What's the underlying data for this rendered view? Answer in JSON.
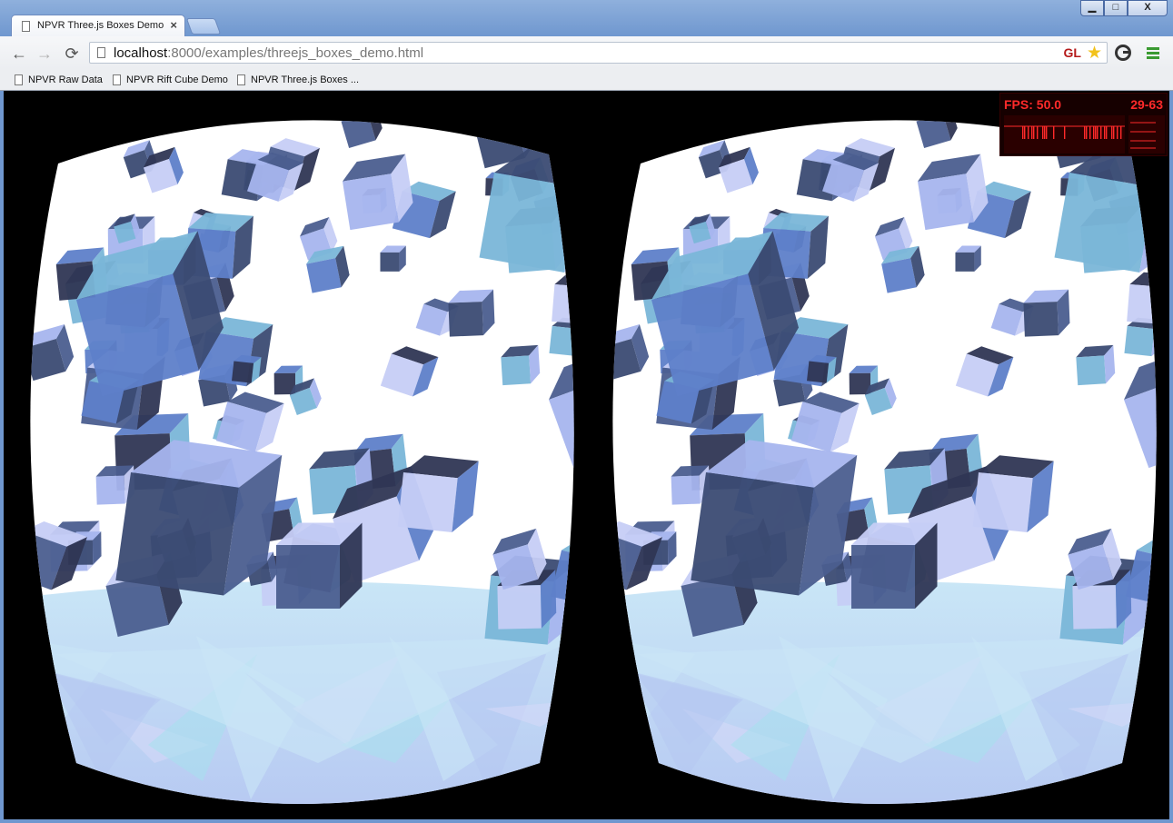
{
  "browser": {
    "tab": {
      "title": "NPVR Three.js Boxes Demo",
      "close_glyph": "×"
    },
    "window_controls": {
      "minimize": "▁",
      "maximize": "□",
      "close": "X"
    },
    "nav": {
      "back": "←",
      "forward": "→",
      "reload": "⟳"
    },
    "address": {
      "host": "localhost",
      "rest": ":8000/examples/threejs_boxes_demo.html"
    },
    "extensions": {
      "gl_badge": "GL",
      "star": "★"
    },
    "bookmarks": [
      {
        "label": "NPVR Raw Data"
      },
      {
        "label": "NPVR Rift Cube Demo"
      },
      {
        "label": "NPVR Three.js Boxes ..."
      }
    ]
  },
  "stats": {
    "fps_text": "FPS: 50.0",
    "range_text": "29-63",
    "color": "#ff2a2a"
  },
  "scene": {
    "background": "#ffffff",
    "cube_palette": [
      "#5e7fc9",
      "#7ab6d8",
      "#3b4b73",
      "#a7b5ee",
      "#4b5e8f",
      "#c6cdf6",
      "#2f3654"
    ],
    "ground_palette": [
      "#c9e6f6",
      "#b6c8f2",
      "#d3d8f8",
      "#a8e0ee"
    ]
  }
}
